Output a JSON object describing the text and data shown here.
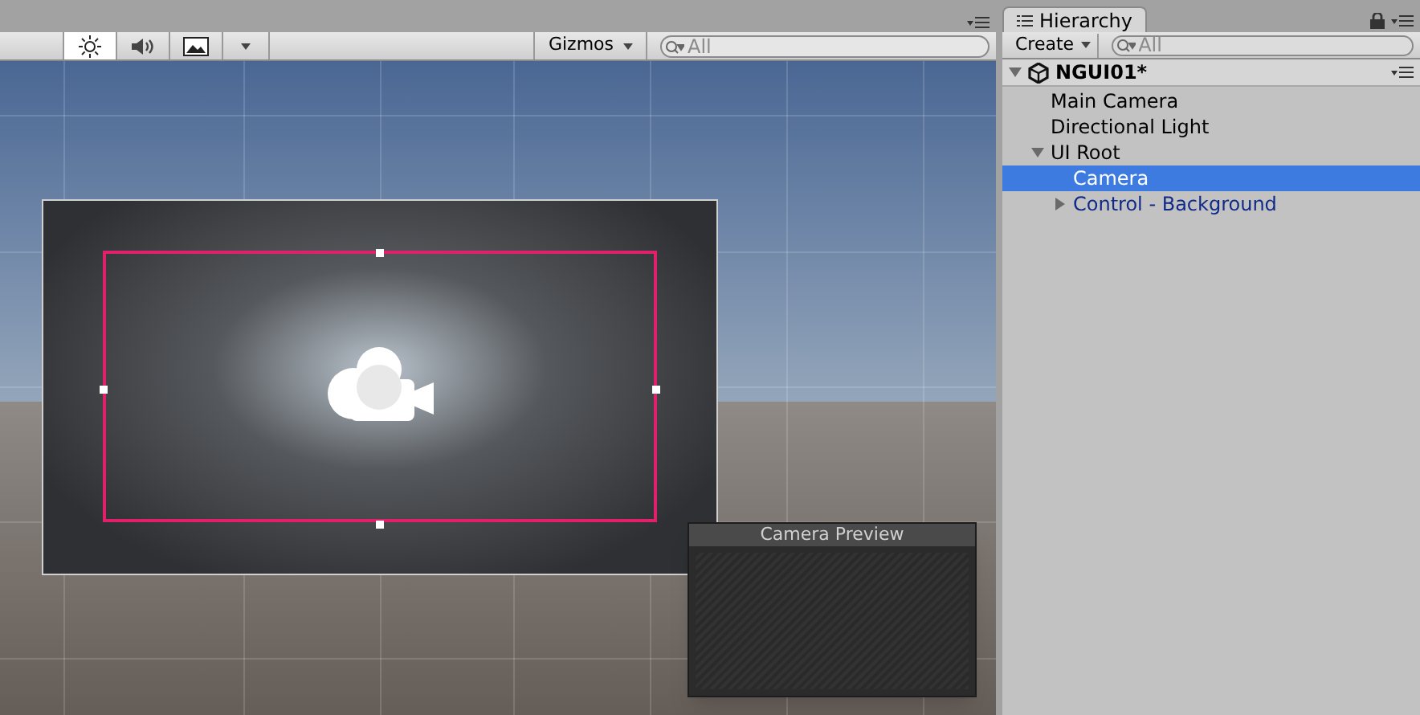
{
  "scene_toolbar": {
    "toggles": [
      {
        "kind": "lighting",
        "selected": true
      },
      {
        "kind": "audio",
        "selected": false
      },
      {
        "kind": "effects",
        "selected": false
      }
    ],
    "gizmos": "Gizmos",
    "search": {
      "placeholder": "All"
    }
  },
  "camera_preview": {
    "title": "Camera Preview"
  },
  "hierarchy": {
    "tab": "Hierarchy",
    "create": "Create",
    "search": {
      "placeholder": "All"
    },
    "scene": {
      "name": "NGUI01*",
      "expanded": true
    },
    "items": [
      {
        "label": "Main Camera",
        "selected": false,
        "prefab": false
      },
      {
        "label": "Directional Light",
        "selected": false,
        "prefab": false
      },
      {
        "label": "UI Root",
        "selected": false,
        "prefab": false,
        "expanded": true,
        "children": [
          {
            "label": "Camera",
            "selected": true,
            "prefab": false
          },
          {
            "label": "Control - Background",
            "selected": false,
            "prefab": true,
            "expanded": false
          }
        ]
      }
    ]
  }
}
